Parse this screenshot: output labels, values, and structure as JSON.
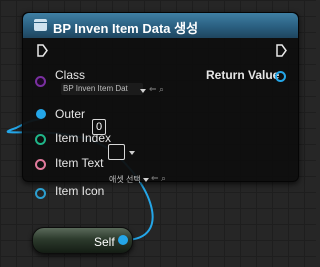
{
  "node": {
    "title": "BP Inven Item Data 생성",
    "inputs": [
      {
        "label": "Class",
        "value": "BP Inven Item Dat",
        "pin_color": "#7a2fa0"
      },
      {
        "label": "Outer",
        "pin_color": "#24a6e8"
      },
      {
        "label": "Item Index",
        "value": "0",
        "pin_color": "#1fb589"
      },
      {
        "label": "Item Text",
        "value": "",
        "pin_color": "#e07a9c"
      },
      {
        "label": "Item Icon",
        "value": "애셋 선택",
        "pin_color": "#2c9fd0"
      }
    ],
    "output": {
      "label": "Return Value",
      "pin_color": "#24a6e8"
    }
  },
  "self_node": {
    "label": "Self",
    "pin_color": "#24a6e8"
  },
  "colors": {
    "header": "#2a5f80",
    "wire": "#24a6e8",
    "background": "#262626"
  }
}
